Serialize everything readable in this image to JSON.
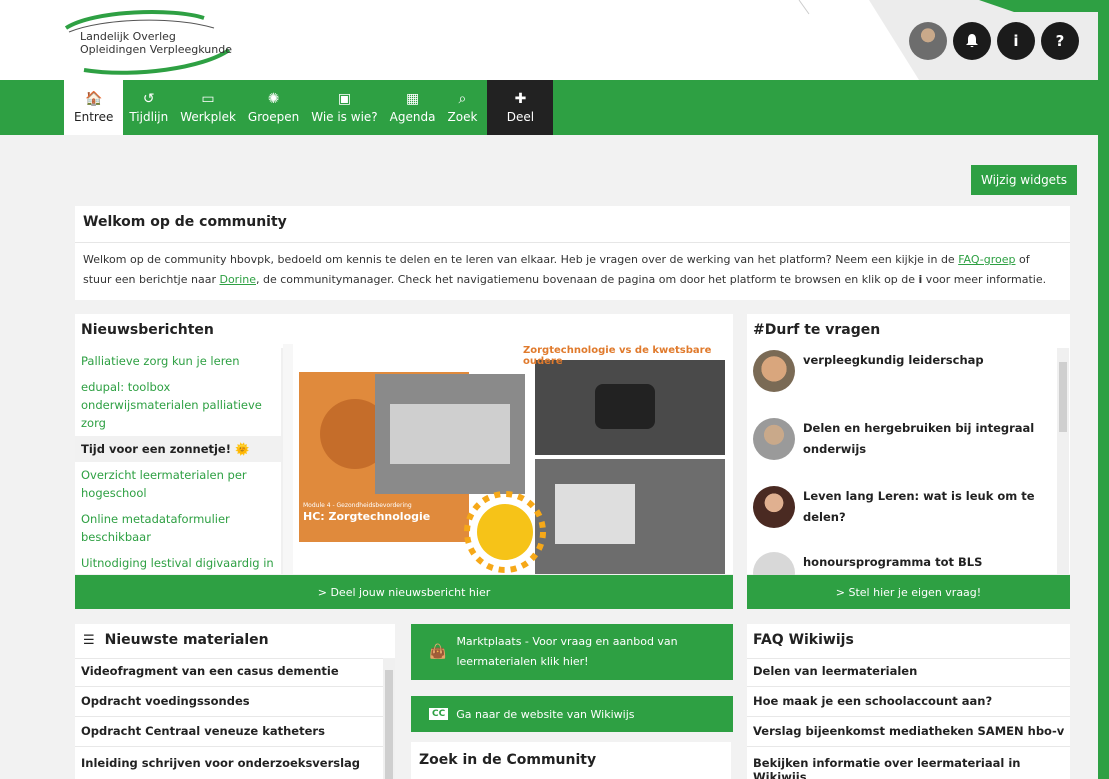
{
  "header": {
    "logo_line1": "Landelijk Overleg",
    "logo_line2": "Opleidingen Verpleegkunde",
    "icons": [
      "avatar",
      "bell-icon",
      "info-icon",
      "help-icon"
    ],
    "info_glyph": "i",
    "help_glyph": "?"
  },
  "colors": {
    "accent": "#2ea043",
    "dark": "#1b1b1b",
    "background": "#f2f2f2"
  },
  "nav": {
    "items": [
      {
        "label": "Entree",
        "icon": "home-icon"
      },
      {
        "label": "Tijdlijn",
        "icon": "history-icon"
      },
      {
        "label": "Werkplek",
        "icon": "monitor-icon"
      },
      {
        "label": "Groepen",
        "icon": "groups-icon"
      },
      {
        "label": "Wie is wie?",
        "icon": "contacts-icon"
      },
      {
        "label": "Agenda",
        "icon": "calendar-icon"
      },
      {
        "label": "Zoek",
        "icon": "search-icon"
      },
      {
        "label": "Deel",
        "icon": "plus-icon"
      }
    ]
  },
  "widgets_button": "Wijzig widgets",
  "welcome": {
    "title": "Welkom op de community",
    "text_1": "Welkom op de community hbovpk, bedoeld om kennis te delen en te leren van elkaar. Heb je vragen over de werking van het platform? Neem een kijkje in de ",
    "link_faq": "FAQ-groep",
    "text_2": " of stuur een berichtje naar ",
    "link_dorine": "Dorine",
    "text_3": ", de communitymanager. Check het navigatiemenu bovenaan de pagina om door het platform te browsen en klik op de ",
    "bold_i": "i",
    "text_4": " voor meer informatie."
  },
  "news": {
    "title": "Nieuwsberichten",
    "items": [
      "Palliatieve zorg kun je leren",
      "edupal: toolbox onderwijsmaterialen palliatieve zorg",
      "Tijd voor een zonnetje! 🌞",
      "Overzicht leermaterialen per hogeschool",
      "Online metadataformulier beschikbaar",
      "Uitnodiging lestival digivaardig in de"
    ],
    "image_title": "Zorgtechnologie vs de kwetsbare oudere",
    "image_caption_small": "Module 4 - Gezondheidsbevordering",
    "image_caption": "HC: Zorgtechnologie",
    "button": "> Deel jouw nieuwsbericht hier"
  },
  "durf": {
    "title": "#Durf te vragen",
    "items": [
      "verpleegkundig leiderschap",
      "Delen en hergebruiken bij integraal onderwijs",
      "Leven lang Leren: wat is leuk om te delen?",
      "honoursprogramma tot BLS ambulance"
    ],
    "button": "> Stel hier je eigen vraag!"
  },
  "materials": {
    "title": "Nieuwste materialen",
    "items": [
      "Videofragment van een casus dementie",
      "Opdracht voedingssondes",
      "Opdracht Centraal veneuze katheters",
      "Inleiding schrijven voor onderzoeksverslag"
    ]
  },
  "links": {
    "marktplaats": "Marktplaats - Voor vraag en aanbod van leermaterialen klik hier!",
    "wikiwijs": "Ga naar de website van Wikiwijs",
    "cc_badge": "CC"
  },
  "zoek": {
    "title": "Zoek in de Community"
  },
  "faq": {
    "title": "FAQ Wikiwijs",
    "items": [
      "Delen van leermaterialen",
      "Hoe maak je een schoolaccount aan?",
      "Verslag bijeenkomst mediatheken SAMEN hbo-v",
      "Bekijken informatie over leermateriaal in Wikiwijs"
    ]
  }
}
